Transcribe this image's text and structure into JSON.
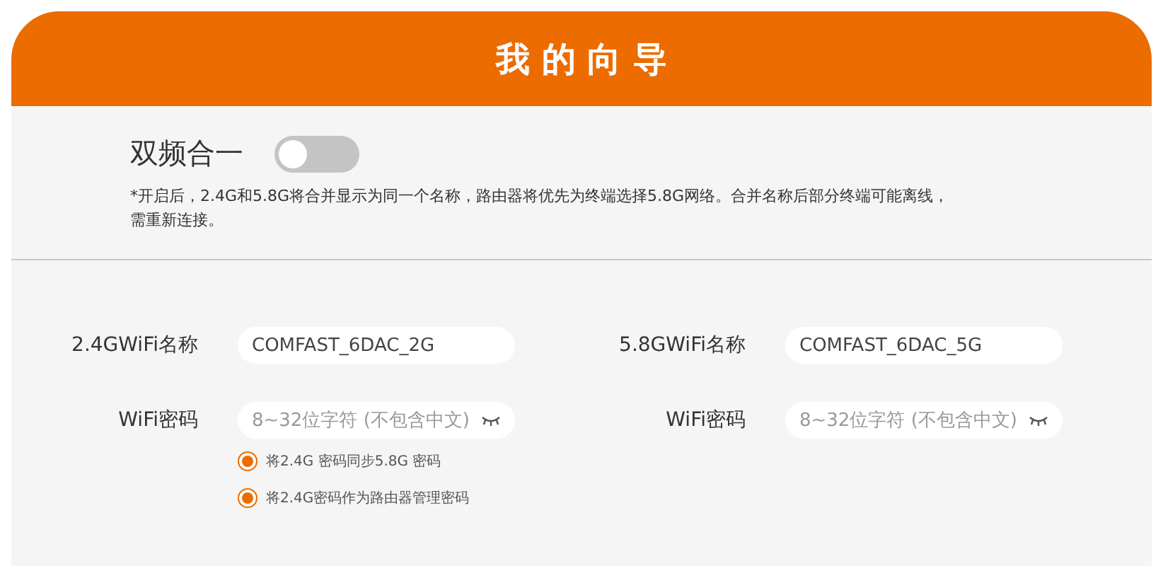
{
  "header": {
    "title": "我 的 向 导"
  },
  "dual_band": {
    "label": "双频合一",
    "on": false,
    "note": "*开启后，2.4G和5.8G将合并显示为同一个名称，路由器将优先为终端选择5.8G网络。合并名称后部分终端可能离线，需重新连接。"
  },
  "columns": [
    {
      "name_label": "2.4GWiFi名称",
      "name_value": "COMFAST_6DAC_2G",
      "password_label": "WiFi密码",
      "password_placeholder": "8~32位字符 (不包含中文)",
      "options": [
        {
          "label": "将2.4G 密码同步5.8G 密码",
          "checked": true
        },
        {
          "label": "将2.4G密码作为路由器管理密码",
          "checked": true
        }
      ]
    },
    {
      "name_label": "5.8GWiFi名称",
      "name_value": "COMFAST_6DAC_5G",
      "password_label": "WiFi密码",
      "password_placeholder": "8~32位字符 (不包含中文)"
    }
  ]
}
